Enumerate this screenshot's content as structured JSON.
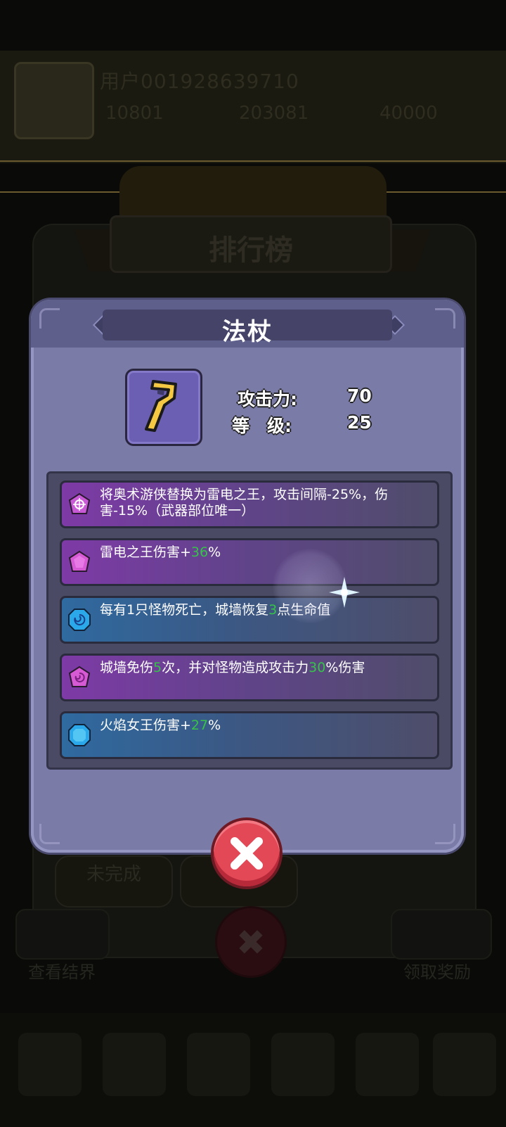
{
  "background": {
    "player_name": "用户001928639710",
    "resources": [
      "10801",
      "203081",
      "40000"
    ],
    "screen_title": "排行榜",
    "buttons": [
      "未完成",
      ""
    ],
    "side_labels": [
      "查看结界",
      "领取奖励"
    ]
  },
  "popup": {
    "title": "法杖",
    "item_icon": "staff-icon",
    "stats": [
      {
        "label": "攻击力:",
        "value": "70"
      },
      {
        "label": "等　级:",
        "value": "25"
      }
    ],
    "effects": [
      {
        "gem": "purple-lightning-gem",
        "color": "purple",
        "parts": [
          {
            "t": "将奥术游侠替换为雷电之王，攻击间隔-25%，伤害-15%（武器部位唯一）"
          }
        ]
      },
      {
        "gem": "purple-gem",
        "color": "purple",
        "parts": [
          {
            "t": "雷电之王伤害+"
          },
          {
            "t": "36",
            "hl": true
          },
          {
            "t": "%"
          }
        ]
      },
      {
        "gem": "blue-swirl-gem",
        "color": "blue",
        "parts": [
          {
            "t": "每有1只怪物死亡，城墙恢复"
          },
          {
            "t": "3",
            "hl": true
          },
          {
            "t": "点生命值"
          }
        ]
      },
      {
        "gem": "purple-swirl-gem",
        "color": "purple",
        "parts": [
          {
            "t": "城墙免伤"
          },
          {
            "t": "5",
            "hl": true
          },
          {
            "t": "次，并对怪物造成攻击力"
          },
          {
            "t": "30",
            "hl": true
          },
          {
            "t": "%伤害"
          }
        ]
      },
      {
        "gem": "blue-gem",
        "color": "blue",
        "parts": [
          {
            "t": "火焰女王伤害+"
          },
          {
            "t": "27",
            "hl": true
          },
          {
            "t": "%"
          }
        ]
      }
    ],
    "close_icon": "close-icon",
    "colors": {
      "highlight": "#37c24b",
      "panel": "#7b7ba8",
      "close": "#e34856"
    }
  }
}
